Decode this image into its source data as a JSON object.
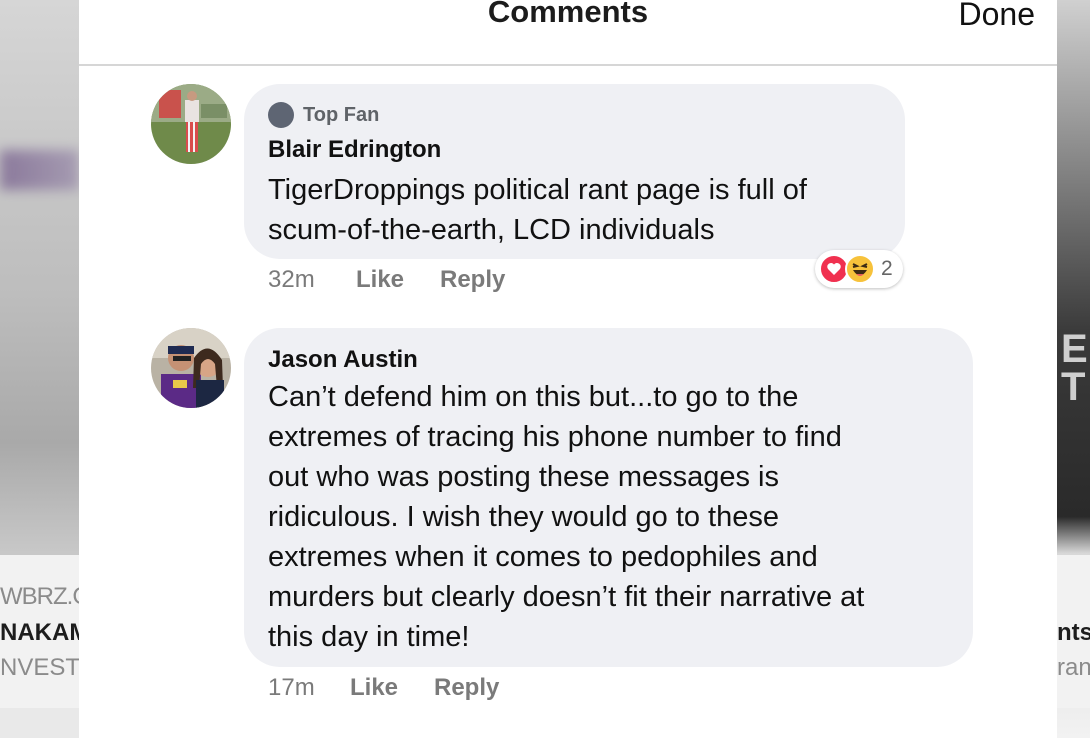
{
  "background": {
    "left_text": [
      "WBRZ.C",
      "NAKAM",
      "NVEST"
    ],
    "right_text": [
      "nts",
      "ran"
    ],
    "right_letters": [
      "E",
      "T"
    ]
  },
  "header": {
    "title": "Comments",
    "done_label": "Done"
  },
  "comments": [
    {
      "badge": "Top Fan",
      "author": "Blair Edrington",
      "text_lines": [
        "TigerDroppings political rant page is full of",
        "scum-of-the-earth, LCD individuals"
      ],
      "time": "32m",
      "like_label": "Like",
      "reply_label": "Reply",
      "reactions": {
        "types": [
          "heart-icon",
          "laugh-icon"
        ],
        "count": "2"
      }
    },
    {
      "author": "Jason Austin",
      "text_lines": [
        "Can’t defend him on this but...to go to the",
        "extremes of tracing his phone number to find",
        "out who was posting these messages is",
        "ridiculous. I wish they would go to these",
        "extremes when it comes to pedophiles and",
        "murders but clearly doesn’t fit their narrative at",
        "this day in time!"
      ],
      "time": "17m",
      "like_label": "Like",
      "reply_label": "Reply"
    }
  ]
}
